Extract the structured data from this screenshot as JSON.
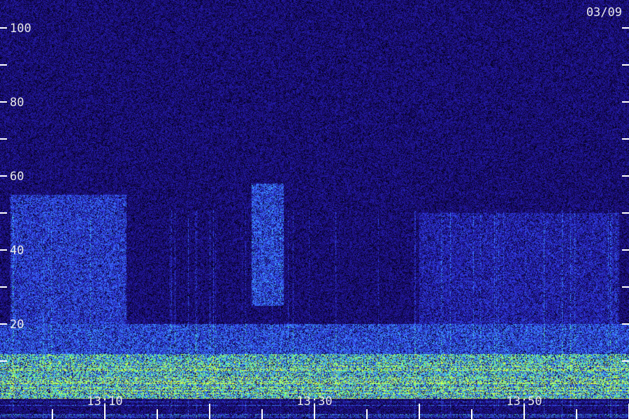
{
  "chart_data": {
    "type": "heatmap",
    "title": "",
    "xlabel": "",
    "ylabel": "",
    "date_label": "03/09",
    "y_axis": {
      "range": [
        0,
        100
      ],
      "labeled_ticks": [
        20,
        40,
        60,
        80,
        100
      ],
      "minor_ticks": [
        10,
        30,
        50,
        70,
        90
      ],
      "tick_labels": [
        "20",
        "40",
        "60",
        "80",
        "100"
      ]
    },
    "x_axis": {
      "range": [
        "13:01",
        "13:59"
      ],
      "tick_labels": [
        "13:10",
        "13:30",
        "13:50"
      ],
      "labeled_tick_times": [
        "13:10",
        "13:30",
        "13:50"
      ],
      "minor_tick_interval_minutes": 5
    },
    "grid": false,
    "colormap": [
      "#000010",
      "#1a0a6e",
      "#2a2ad0",
      "#3a6cff",
      "#40c0ff",
      "#60ff80",
      "#e0ff40"
    ],
    "intensity_features": [
      {
        "kind": "band",
        "y_range": [
          0,
          12
        ],
        "level": 0.85
      },
      {
        "kind": "band",
        "y_range": [
          12,
          20
        ],
        "level": 0.55
      },
      {
        "kind": "patch",
        "time_range": [
          "13:01",
          "13:12"
        ],
        "y_range": [
          20,
          55
        ],
        "level": 0.5
      },
      {
        "kind": "patch",
        "time_range": [
          "13:24",
          "13:27"
        ],
        "y_range": [
          25,
          58
        ],
        "level": 0.55
      },
      {
        "kind": "patch",
        "time_range": [
          "13:40",
          "13:59"
        ],
        "y_range": [
          20,
          50
        ],
        "level": 0.4
      }
    ]
  }
}
